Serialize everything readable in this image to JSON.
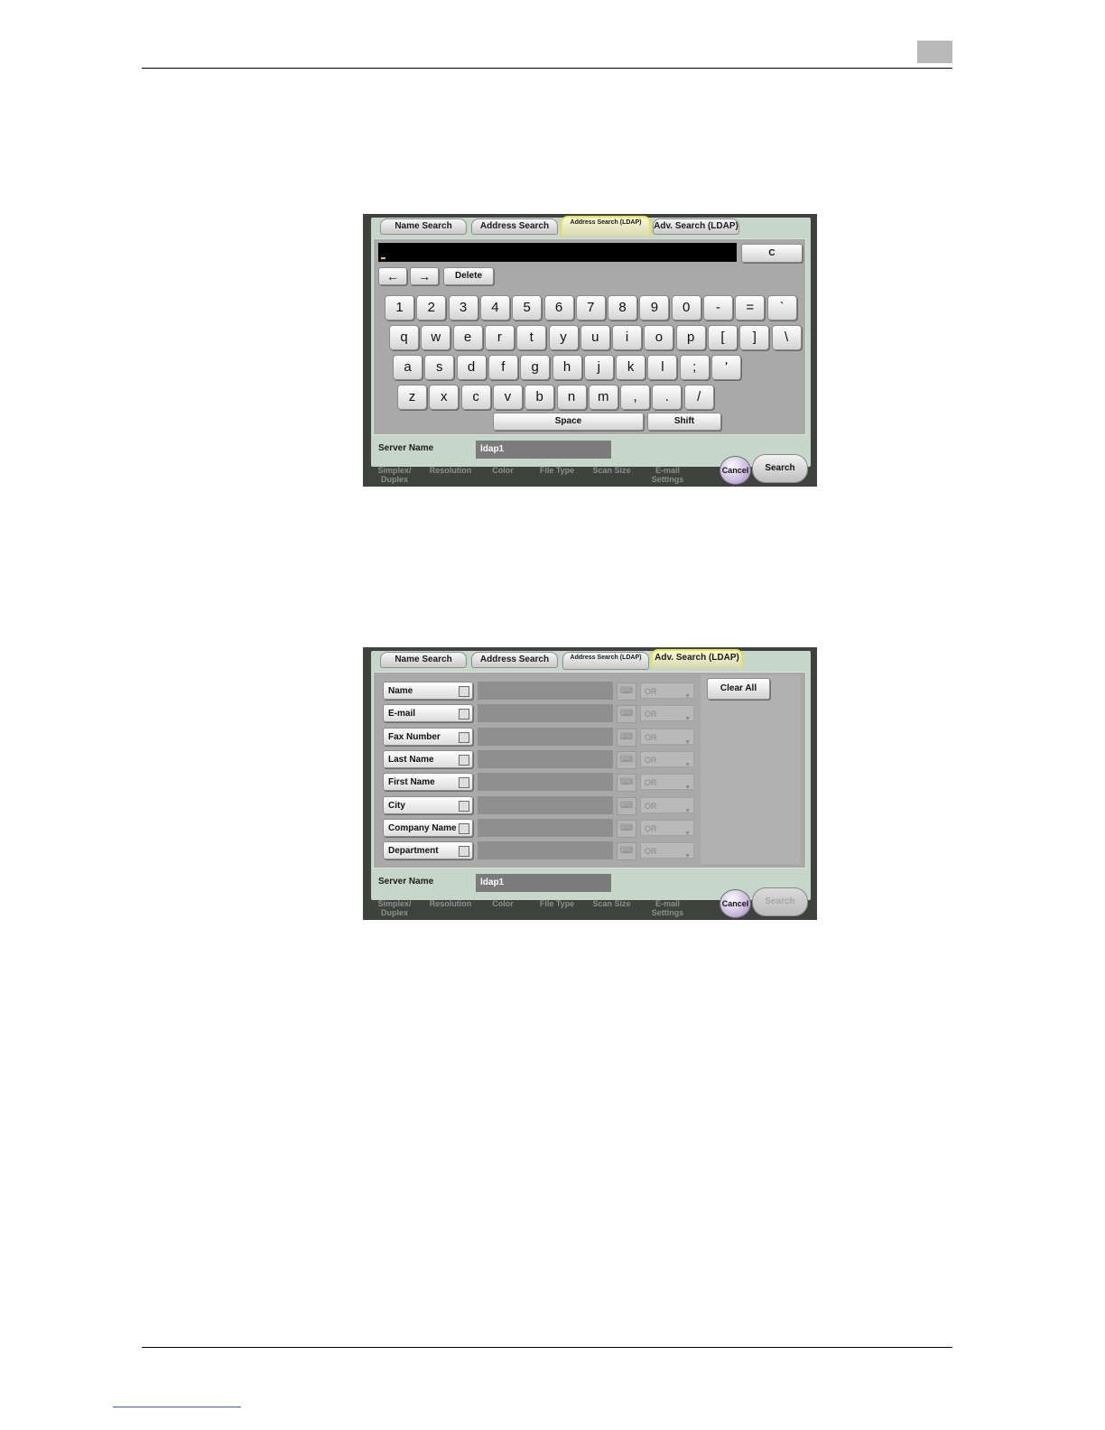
{
  "panel1": {
    "tabs": [
      "Name Search",
      "Address Search",
      "Address Search (LDAP)",
      "Adv. Search (LDAP)"
    ],
    "clear_label": "C",
    "left_arrow": "←",
    "right_arrow": "→",
    "delete_label": "Delete",
    "keyboard": {
      "row1": [
        "1",
        "2",
        "3",
        "4",
        "5",
        "6",
        "7",
        "8",
        "9",
        "0",
        "-",
        "=",
        "`"
      ],
      "row2": [
        "q",
        "w",
        "e",
        "r",
        "t",
        "y",
        "u",
        "i",
        "o",
        "p",
        "[",
        "]",
        "\\"
      ],
      "row3": [
        "a",
        "s",
        "d",
        "f",
        "g",
        "h",
        "j",
        "k",
        "l",
        ";",
        "'"
      ],
      "row4": [
        "z",
        "x",
        "c",
        "v",
        "b",
        "n",
        "m",
        ",",
        ".",
        "/"
      ],
      "space_label": "Space",
      "shift_label": "Shift"
    },
    "server_name_label": "Server Name",
    "server_name_value": "ldap1",
    "cancel_label": "Cancel",
    "search_label": "Search",
    "background_labels": [
      "Simplex/ Duplex",
      "Resolution",
      "Color",
      "File Type",
      "Scan Size",
      "E-mail Settings"
    ]
  },
  "panel2": {
    "tabs": [
      "Name Search",
      "Address Search",
      "Address Search (LDAP)",
      "Adv. Search (LDAP)"
    ],
    "fields": [
      "Name",
      "E-mail",
      "Fax Number",
      "Last Name",
      "First Name",
      "City",
      "Company Name",
      "Department"
    ],
    "operator": "OR",
    "clear_all_label": "Clear All",
    "server_name_label": "Server Name",
    "server_name_value": "ldap1",
    "cancel_label": "Cancel",
    "search_label": "Search",
    "background_labels": [
      "Simplex/ Duplex",
      "Resolution",
      "Color",
      "File Type",
      "Scan Size",
      "E-mail Settings"
    ]
  },
  "colors": {
    "frame": "#c6d6c8",
    "active_tab_border": "#e6e64a",
    "content_gray": "#a9a9a9",
    "panel_dark": "#3e433e"
  }
}
